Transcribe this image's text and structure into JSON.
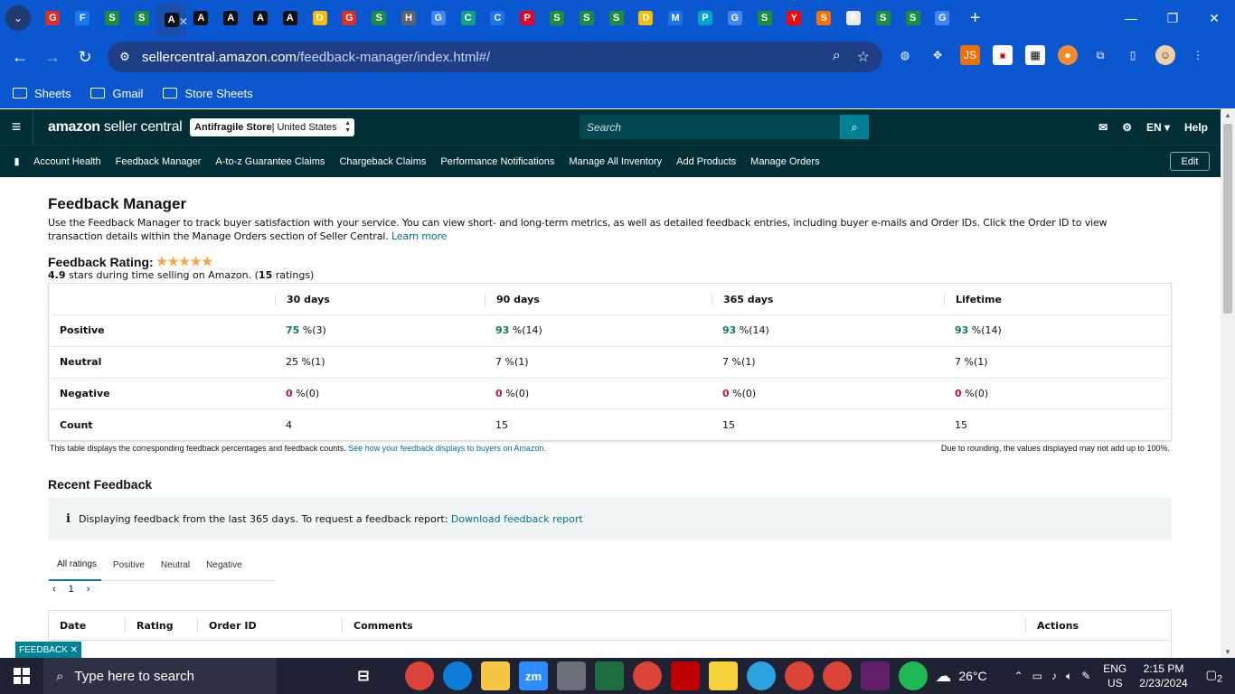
{
  "browser": {
    "tab_favicons": [
      {
        "icon": "gmail-icon",
        "color": "#d93025"
      },
      {
        "icon": "facebook-icon",
        "color": "#1877f2"
      },
      {
        "icon": "sheets-icon",
        "color": "#1e8e3e"
      },
      {
        "icon": "sheets-icon",
        "color": "#1e8e3e"
      },
      {
        "icon": "amazon-icon",
        "color": "#111111"
      },
      {
        "icon": "amazon-icon",
        "color": "#111111"
      },
      {
        "icon": "amazon-icon",
        "color": "#111111"
      },
      {
        "icon": "amazon-icon",
        "color": "#111111"
      },
      {
        "icon": "amazon-icon",
        "color": "#111111"
      },
      {
        "icon": "drive-icon",
        "color": "#fbbc04"
      },
      {
        "icon": "gmail-icon",
        "color": "#d93025"
      },
      {
        "icon": "sheets-icon",
        "color": "#1e8e3e"
      },
      {
        "icon": "history-icon",
        "color": "#5f6368"
      },
      {
        "icon": "google-icon",
        "color": "#4285f4"
      },
      {
        "icon": "chatgpt-icon",
        "color": "#10a37f"
      },
      {
        "icon": "calendar-icon",
        "color": "#1a73e8"
      },
      {
        "icon": "pinterest-icon",
        "color": "#e60023"
      },
      {
        "icon": "sheets-icon",
        "color": "#1e8e3e"
      },
      {
        "icon": "sheets-icon",
        "color": "#1e8e3e"
      },
      {
        "icon": "sheets-icon",
        "color": "#1e8e3e"
      },
      {
        "icon": "drive-icon",
        "color": "#fbbc04"
      },
      {
        "icon": "maps-icon",
        "color": "#1a73e8"
      },
      {
        "icon": "pliro-icon",
        "color": "#00a5c8"
      },
      {
        "icon": "google-icon",
        "color": "#4285f4"
      },
      {
        "icon": "sheets-icon",
        "color": "#1e8e3e"
      },
      {
        "icon": "youtube-icon",
        "color": "#ff0000"
      },
      {
        "icon": "sas-icon",
        "color": "#ff6f00"
      },
      {
        "icon": "photos-icon",
        "color": "#e8eaed"
      },
      {
        "icon": "sheets-icon",
        "color": "#1e8e3e"
      },
      {
        "icon": "sheets-icon",
        "color": "#1e8e3e"
      },
      {
        "icon": "google-icon",
        "color": "#4285f4"
      }
    ],
    "url_host": "sellercentral.amazon.com",
    "url_path": "/feedback-manager/index.html#/",
    "bookmarks": [
      "Sheets",
      "Gmail",
      "Store Sheets"
    ],
    "accent": "#0b57d0"
  },
  "header": {
    "logo_brand": "amazon",
    "logo_product": " seller central",
    "store_name": "Antifragile Store",
    "store_region": " | United States",
    "search_placeholder": "Search",
    "language": "EN ▾",
    "help": "Help"
  },
  "nav": {
    "items": [
      "Account Health",
      "Feedback Manager",
      "A-to-z Guarantee Claims",
      "Chargeback Claims",
      "Performance Notifications",
      "Manage All Inventory",
      "Add Products",
      "Manage Orders"
    ],
    "edit": "Edit"
  },
  "page": {
    "title": "Feedback Manager",
    "description": "Use the Feedback Manager to track buyer satisfaction with your service. You can view short- and long-term metrics, as well as detailed feedback entries, including buyer e-mails and Order IDs. Click the Order ID to view transaction details within the Manage Orders section of Seller Central.",
    "learn_more": "Learn more",
    "rating_label": "Feedback Rating:",
    "rating_stars": 5,
    "rating_value": "4.9",
    "rating_mid": " stars during time selling on Amazon. (",
    "rating_count": "15",
    "rating_end": " ratings)"
  },
  "feedback_table": {
    "columns": [
      "30 days",
      "90 days",
      "365 days",
      "Lifetime"
    ],
    "rows": [
      {
        "label": "Positive",
        "cells": [
          {
            "pct": "75",
            "rest": " %(3)"
          },
          {
            "pct": "93",
            "rest": " %(14)"
          },
          {
            "pct": "93",
            "rest": " %(14)"
          },
          {
            "pct": "93",
            "rest": " %(14)"
          }
        ]
      },
      {
        "label": "Neutral",
        "cells": [
          {
            "pct": "25",
            "rest": " %(1)"
          },
          {
            "pct": "7",
            "rest": " %(1)"
          },
          {
            "pct": "7",
            "rest": " %(1)"
          },
          {
            "pct": "7",
            "rest": " %(1)"
          }
        ]
      },
      {
        "label": "Negative",
        "cells": [
          {
            "pct": "0",
            "rest": " %(0)"
          },
          {
            "pct": "0",
            "rest": " %(0)"
          },
          {
            "pct": "0",
            "rest": " %(0)"
          },
          {
            "pct": "0",
            "rest": " %(0)"
          }
        ]
      },
      {
        "label": "Count",
        "cells": [
          {
            "pct": "",
            "rest": "4"
          },
          {
            "pct": "",
            "rest": "15"
          },
          {
            "pct": "",
            "rest": "15"
          },
          {
            "pct": "",
            "rest": "15"
          }
        ]
      }
    ],
    "note_left": "This table displays the corresponding feedback percentages and feedback counts.",
    "note_link": "See how your feedback displays to buyers on Amazon.",
    "note_right": "Due to rounding, the values displayed may not add up to 100%.",
    "positive_color": "#067d62",
    "negative_color": "#cc0c39"
  },
  "recent": {
    "title": "Recent Feedback",
    "info_text": "Displaying feedback from the last 365 days. To request a feedback report:",
    "info_link": "Download feedback report",
    "tabs": [
      "All ratings",
      "Positive",
      "Neutral",
      "Negative"
    ],
    "page": "1",
    "columns": [
      "Date",
      "Rating",
      "Order ID",
      "Comments",
      "Actions"
    ],
    "feedback_tab": "FEEDBACK ✕"
  },
  "taskbar": {
    "search_placeholder": "Type here to search",
    "apps": [
      {
        "icon": "chrome-icon",
        "color": "#db4437"
      },
      {
        "icon": "edge-icon",
        "color": "#0f7bd8"
      },
      {
        "icon": "explorer-icon",
        "color": "#f4c542"
      },
      {
        "icon": "zoom-icon",
        "color": "#2d8cff",
        "text": "zm"
      },
      {
        "icon": "calculator-icon",
        "color": "#6b6f7a"
      },
      {
        "icon": "excel-icon",
        "color": "#1d6f42"
      },
      {
        "icon": "chrome-icon",
        "color": "#db4437"
      },
      {
        "icon": "filezilla-icon",
        "color": "#bf0000"
      },
      {
        "icon": "sticky-notes-icon",
        "color": "#f7d23b"
      },
      {
        "icon": "telegram-icon",
        "color": "#2aa3df"
      },
      {
        "icon": "chrome-icon",
        "color": "#db4437"
      },
      {
        "icon": "chrome-icon",
        "color": "#db4437"
      },
      {
        "icon": "slack-icon",
        "color": "#611f69"
      },
      {
        "icon": "spotify-icon",
        "color": "#1db954"
      }
    ],
    "weather": "26°C",
    "lang_line1": "ENG",
    "lang_line2": "US",
    "time": "2:15 PM",
    "date": "2/23/2024",
    "notifications": "2"
  }
}
